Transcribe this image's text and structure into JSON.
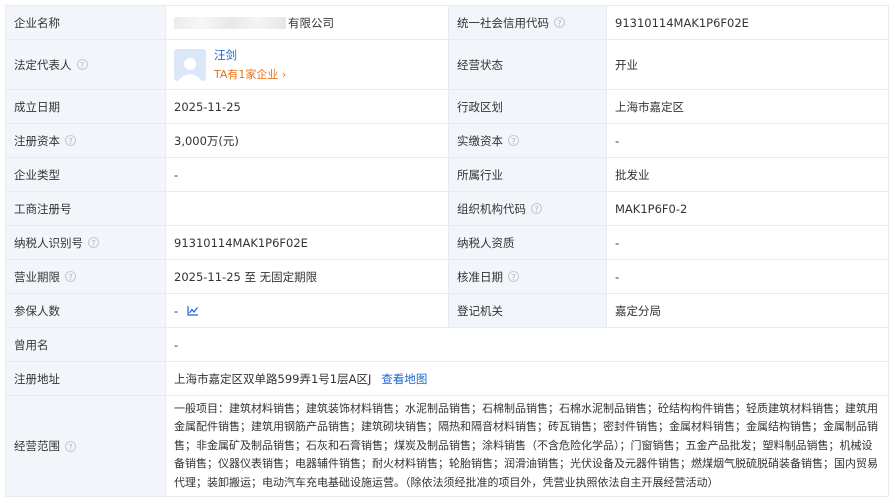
{
  "rows": {
    "r1": {
      "l1": "企业名称",
      "v1_suffix": "有限公司",
      "l2": "统一社会信用代码",
      "v2": "91310114MAK1P6F02E"
    },
    "r2": {
      "l1": "法定代表人",
      "person_name": "汪剑",
      "person_sub": "TA有1家企业 ›",
      "l2": "经营状态",
      "v2": "开业"
    },
    "r3": {
      "l1": "成立日期",
      "v1": "2025-11-25",
      "l2": "行政区划",
      "v2": "上海市嘉定区"
    },
    "r4": {
      "l1": "注册资本",
      "v1": "3,000万(元)",
      "l2": "实缴资本",
      "v2": "-"
    },
    "r5": {
      "l1": "企业类型",
      "v1": "-",
      "l2": "所属行业",
      "v2": "批发业"
    },
    "r6": {
      "l1": "工商注册号",
      "v1": "",
      "l2": "组织机构代码",
      "v2": "MAK1P6F0-2"
    },
    "r7": {
      "l1": "纳税人识别号",
      "v1": "91310114MAK1P6F02E",
      "l2": "纳税人资质",
      "v2": "-"
    },
    "r8": {
      "l1": "营业期限",
      "v1": "2025-11-25 至 无固定期限",
      "l2": "核准日期",
      "v2": "-"
    },
    "r9": {
      "l1": "参保人数",
      "v1": "-",
      "l2": "登记机关",
      "v2": "嘉定分局"
    },
    "r10": {
      "l1": "曾用名",
      "v1": "-"
    },
    "r11": {
      "l1": "注册地址",
      "v1": "上海市嘉定区双单路599弄1号1层A区J",
      "link": "查看地图"
    },
    "r12": {
      "l1": "经营范围",
      "v1": "一般项目：建筑材料销售；建筑装饰材料销售；水泥制品销售；石棉制品销售；石棉水泥制品销售；砼结构构件销售；轻质建筑材料销售；建筑用金属配件销售；建筑用钢筋产品销售；建筑砌块销售；隔热和隔音材料销售；砖瓦销售；密封件销售；金属材料销售；金属结构销售；金属制品销售；非金属矿及制品销售；石灰和石膏销售；煤炭及制品销售；涂料销售（不含危险化学品）；门窗销售；五金产品批发；塑料制品销售；机械设备销售；仪器仪表销售；电器辅件销售；耐火材料销售；轮胎销售；润滑油销售；光伏设备及元器件销售；燃煤烟气脱硫脱硝装备销售；国内贸易代理；装卸搬运；电动汽车充电基础设施运营。（除依法须经批准的项目外，凭营业执照依法自主开展经营活动）"
    }
  },
  "icons": {
    "help": "question-circle-icon",
    "trend": "trend-chart-icon",
    "avatar": "person-avatar-icon"
  },
  "colors": {
    "label_bg": "#f2f6fb",
    "border": "#e6ebf2",
    "link": "#1a66d6",
    "accent": "#e8741b"
  }
}
